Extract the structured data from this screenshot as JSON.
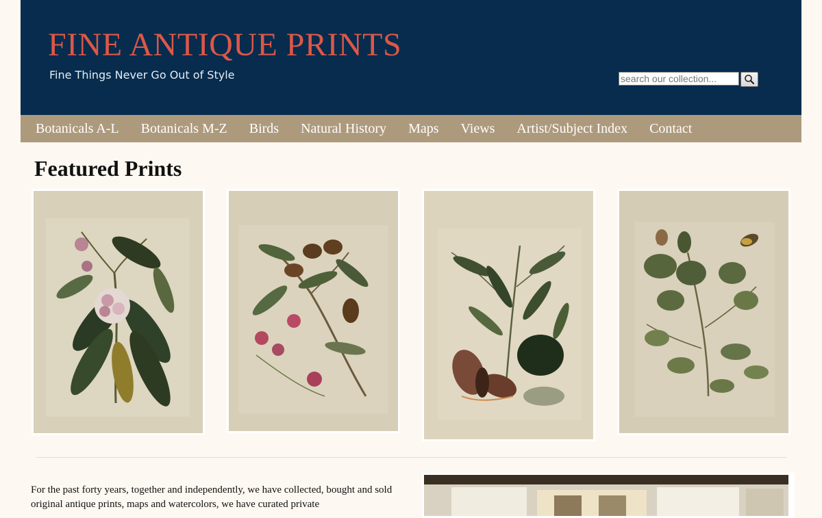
{
  "site": {
    "logo": "FINE ANTIQUE PRINTS",
    "tagline": "Fine Things Never Go Out of Style"
  },
  "search": {
    "placeholder": "search our collection...",
    "button_icon": "magnifier-icon"
  },
  "nav": {
    "items": [
      {
        "label": "Botanicals A-L"
      },
      {
        "label": "Botanicals M-Z"
      },
      {
        "label": "Birds"
      },
      {
        "label": "Natural History"
      },
      {
        "label": "Maps"
      },
      {
        "label": "Views"
      },
      {
        "label": "Artist/Subject Index"
      },
      {
        "label": "Contact"
      }
    ]
  },
  "featured": {
    "heading": "Featured Prints"
  },
  "intro": {
    "text": "For the past forty years, together and independently, we have collected, bought and sold original antique prints, maps and watercolors, we have curated private"
  },
  "colors": {
    "header_bg": "#072c4e",
    "logo": "#de5747",
    "nav_bg": "#ad9a7d",
    "page_bg": "#fdf8f2"
  }
}
